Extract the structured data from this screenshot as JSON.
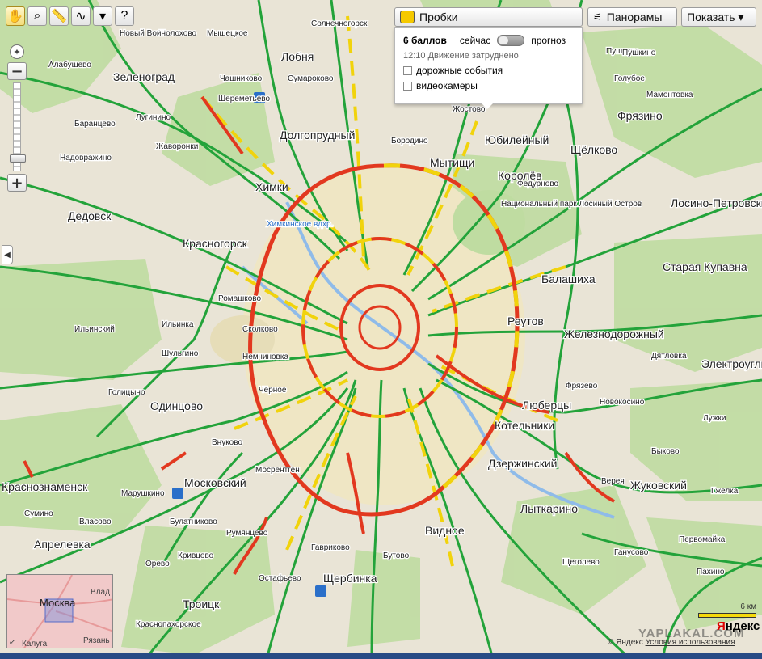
{
  "traffic_panel": {
    "title": "Пробки",
    "score": "6 баллов",
    "now_label": "сейчас",
    "forecast_label": "прогноз",
    "status": "12:10 Движение затруднено",
    "checkbox_events": "дорожные события",
    "checkbox_cameras": "видеокамеры"
  },
  "buttons": {
    "panoramas": "Панорамы",
    "show": "Показать ▾"
  },
  "minimap": {
    "label": "Москва",
    "places": [
      "Влад",
      "Рязань",
      "Калуга"
    ]
  },
  "scale_label": "6 км",
  "copyright": {
    "prefix": "© Яндекс",
    "link": "Условия использования"
  },
  "logo": {
    "first": "Я",
    "rest": "ндекс"
  },
  "watermark": "YAPLAKAL.COM",
  "colors": {
    "map_bg": "#e9e4d6",
    "forest": "#bfdca1",
    "city": "#efe6c4",
    "jam_green": "#23a33a",
    "jam_yellow": "#f1d30c",
    "jam_red": "#e2381f",
    "water": "#a6cbef"
  },
  "map_labels": [
    "Солнечногорск",
    "Шолохово",
    "Новый Воин",
    "Мышецкое",
    "Лобня",
    "Пушкино",
    "Алабушево",
    "Сумароково",
    "Чашниково",
    "Зеленоград",
    "Голубое",
    "Лугинино",
    "Баранцево",
    "Жаворонки",
    "Надовражино",
    "Долгопрудный",
    "Шереметьево",
    "Бородино",
    "Мытищи",
    "Юбилейный",
    "Щёлково",
    "Фрязино",
    "Химки",
    "Химкинское вдхр.",
    "Королёв",
    "Мамонтовка",
    "Дедовск",
    "Красногорск",
    "Национальный парк Лосиный Остров",
    "Лосино-Петровский",
    "Старая Купавна",
    "Балашиха",
    "Реутов",
    "Железнодорожный",
    "Электроугли",
    "Одинцово",
    "Люберцы",
    "Котельники",
    "Дзержинский",
    "Лыткарино",
    "Жуковский",
    "Видное",
    "Щербинка",
    "Троицк",
    "Апрелевка",
    "Краснознаменск",
    "Московский",
    "Внуково",
    "Сколково",
    "Новокосино",
    "Гавриково",
    "Пушкино",
    "Голицыно",
    "Марушкино",
    "Сумино",
    "Власово",
    "Булатниково",
    "Бутово",
    "Остафьево",
    "Румянцево",
    "Краснопахорское",
    "Мосрентген",
    "Немчиновка",
    "Ромашково",
    "Дятловка",
    "Лужки",
    "Верея",
    "Быково",
    "Ильинский",
    "Гжелка",
    "Шульгино",
    "Ильинка",
    "Жостово",
    "Фрязево",
    "Федурново",
    "Чёрное",
    "Кривцово",
    "Орево",
    "Первомайка",
    "Щеголево",
    "Ганусово",
    "Пахино"
  ]
}
